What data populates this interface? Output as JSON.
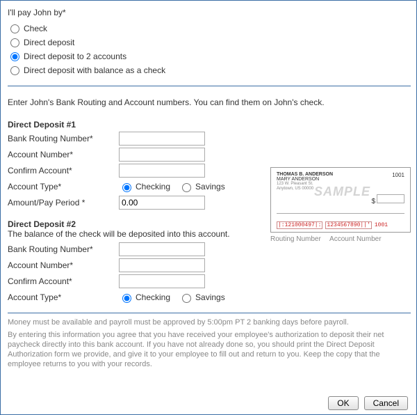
{
  "prompt": "I'll pay John by*",
  "pay_options": [
    {
      "label": "Check",
      "value": "check"
    },
    {
      "label": "Direct deposit",
      "value": "dd1"
    },
    {
      "label": "Direct deposit to 2 accounts",
      "value": "dd2"
    },
    {
      "label": "Direct deposit with balance as a check",
      "value": "ddcheck"
    }
  ],
  "pay_selected": "dd2",
  "enter_text": "Enter John's Bank Routing and Account numbers. You can find them on John's check.",
  "dd1": {
    "title": "Direct Deposit #1",
    "labels": {
      "routing": "Bank Routing Number*",
      "account": "Account Number*",
      "confirm": "Confirm Account*",
      "type": "Account Type*",
      "amount": "Amount/Pay Period *"
    },
    "values": {
      "routing": "",
      "account": "",
      "confirm": "",
      "amount": "0.00"
    },
    "type_options": {
      "checking": "Checking",
      "savings": "Savings"
    },
    "type_selected": "checking"
  },
  "dd2": {
    "title": "Direct Deposit #2",
    "note": "The balance of the check will be deposited into this account.",
    "labels": {
      "routing": "Bank Routing Number*",
      "account": "Account Number*",
      "confirm": "Confirm Account*",
      "type": "Account Type*"
    },
    "values": {
      "routing": "",
      "account": "",
      "confirm": ""
    },
    "type_options": {
      "checking": "Checking",
      "savings": "Savings"
    },
    "type_selected": "checking"
  },
  "check_image": {
    "name1": "THOMAS B. ANDERSON",
    "name2": "MARY ANDERSON",
    "addr1": "123 W. Pleasant St.",
    "addr2": "Anytown, US 00000",
    "check_no": "1001",
    "sample": "SAMPLE",
    "dollar": "$",
    "routing": "|:121000497|:",
    "account": "1234567890||'",
    "seq": "1001"
  },
  "check_caption": {
    "routing": "Routing Number",
    "account": "Account Number"
  },
  "legal": {
    "p1": "Money must be available and payroll must be approved by 5:00pm PT 2 banking days before payroll.",
    "p2": "By entering this information you agree that you have received your employee's authorization to deposit their net paycheck directly into this bank account. If you have not already done so, you should print the Direct Deposit Authorization form we provide, and give it to your employee to fill out and return to you. Keep the copy that the employee returns to you with your records."
  },
  "buttons": {
    "ok": "OK",
    "cancel": "Cancel"
  }
}
